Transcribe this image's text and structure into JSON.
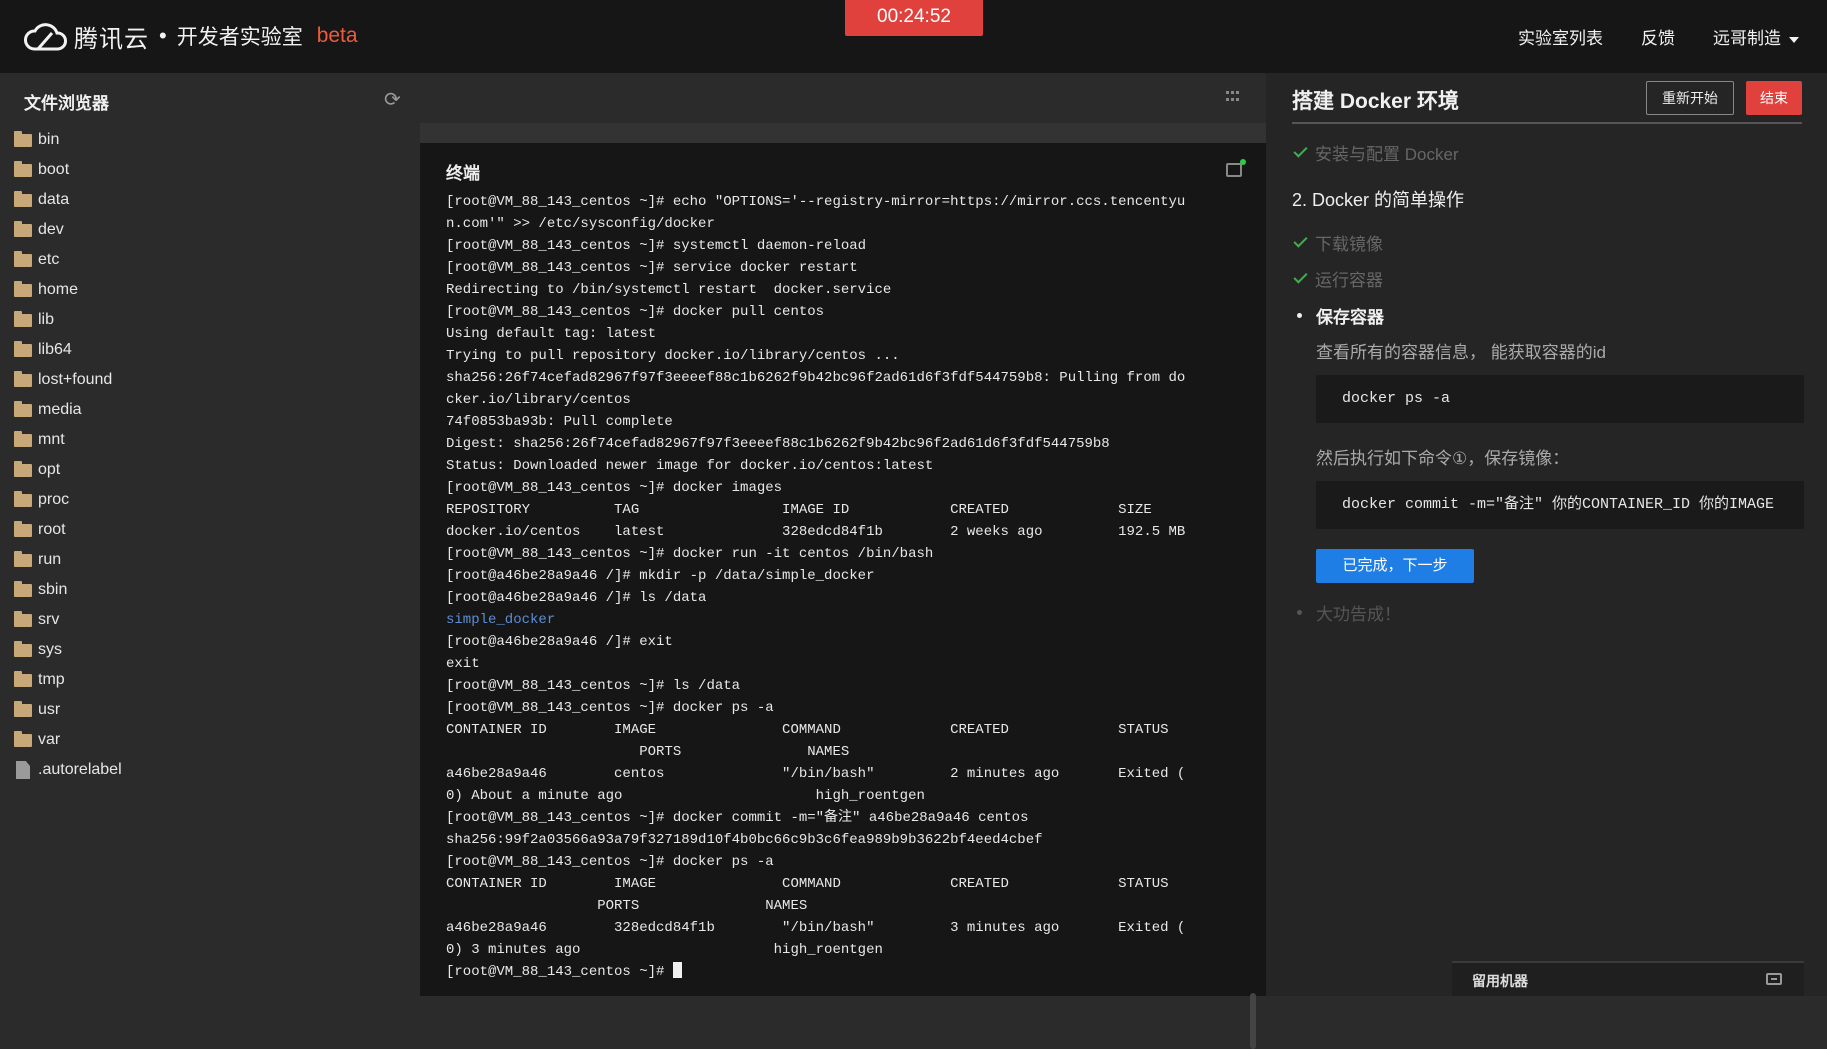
{
  "header": {
    "brand": "腾讯云",
    "separator": "•",
    "subtitle": "开发者实验室",
    "beta": "beta",
    "timer": "00:24:52",
    "nav": [
      "实验室列表",
      "反馈",
      "远哥制造"
    ]
  },
  "filebrowser": {
    "title": "文件浏览器",
    "items": [
      {
        "name": "bin",
        "type": "folder"
      },
      {
        "name": "boot",
        "type": "folder"
      },
      {
        "name": "data",
        "type": "folder"
      },
      {
        "name": "dev",
        "type": "folder"
      },
      {
        "name": "etc",
        "type": "folder"
      },
      {
        "name": "home",
        "type": "folder"
      },
      {
        "name": "lib",
        "type": "folder"
      },
      {
        "name": "lib64",
        "type": "folder"
      },
      {
        "name": "lost+found",
        "type": "folder"
      },
      {
        "name": "media",
        "type": "folder"
      },
      {
        "name": "mnt",
        "type": "folder"
      },
      {
        "name": "opt",
        "type": "folder"
      },
      {
        "name": "proc",
        "type": "folder"
      },
      {
        "name": "root",
        "type": "folder"
      },
      {
        "name": "run",
        "type": "folder"
      },
      {
        "name": "sbin",
        "type": "folder"
      },
      {
        "name": "srv",
        "type": "folder"
      },
      {
        "name": "sys",
        "type": "folder"
      },
      {
        "name": "tmp",
        "type": "folder"
      },
      {
        "name": "usr",
        "type": "folder"
      },
      {
        "name": "var",
        "type": "folder"
      },
      {
        "name": ".autorelabel",
        "type": "file"
      }
    ]
  },
  "terminal": {
    "title": "终端",
    "lines": [
      "[root@VM_88_143_centos ~]# echo \"OPTIONS='--registry-mirror=https://mirror.ccs.tencentyu",
      "n.com'\" >> /etc/sysconfig/docker",
      "[root@VM_88_143_centos ~]# systemctl daemon-reload",
      "[root@VM_88_143_centos ~]# service docker restart",
      "Redirecting to /bin/systemctl restart  docker.service",
      "[root@VM_88_143_centos ~]# docker pull centos",
      "Using default tag: latest",
      "Trying to pull repository docker.io/library/centos ...",
      "sha256:26f74cefad82967f97f3eeeef88c1b6262f9b42bc96f2ad61d6f3fdf544759b8: Pulling from do",
      "cker.io/library/centos",
      "74f0853ba93b: Pull complete",
      "Digest: sha256:26f74cefad82967f97f3eeeef88c1b6262f9b42bc96f2ad61d6f3fdf544759b8",
      "Status: Downloaded newer image for docker.io/centos:latest",
      "[root@VM_88_143_centos ~]# docker images",
      "REPOSITORY          TAG                 IMAGE ID            CREATED             SIZE",
      "docker.io/centos    latest              328edcd84f1b        2 weeks ago         192.5 MB",
      "[root@VM_88_143_centos ~]# docker run -it centos /bin/bash",
      "[root@a46be28a9a46 /]# mkdir -p /data/simple_docker",
      "[root@a46be28a9a46 /]# ls /data",
      "simple_docker",
      "[root@a46be28a9a46 /]# exit",
      "exit",
      "[root@VM_88_143_centos ~]# ls /data",
      "[root@VM_88_143_centos ~]# docker ps -a",
      "CONTAINER ID        IMAGE               COMMAND             CREATED             STATUS",
      "                       PORTS               NAMES",
      "a46be28a9a46        centos              \"/bin/bash\"         2 minutes ago       Exited (",
      "0) About a minute ago                       high_roentgen",
      "[root@VM_88_143_centos ~]# docker commit -m=\"备注\" a46be28a9a46 centos",
      "sha256:99f2a03566a93a79f327189d10f4b0bc66c9b3c6fea989b9b3622bf4eed4cbef",
      "[root@VM_88_143_centos ~]# docker ps -a",
      "CONTAINER ID        IMAGE               COMMAND             CREATED             STATUS",
      "                  PORTS               NAMES",
      "a46be28a9a46        328edcd84f1b        \"/bin/bash\"         3 minutes ago       Exited (",
      "0) 3 minutes ago                       high_roentgen",
      "[root@VM_88_143_centos ~]# "
    ],
    "highlight_line_index": 19
  },
  "guide": {
    "title": "搭建 Docker 环境",
    "restart_label": "重新开始",
    "end_label": "结束",
    "step_done_1": "安装与配置 Docker",
    "section2_title": "2. Docker 的简单操作",
    "step_done_2": "下载镜像",
    "step_done_3": "运行容器",
    "current_step": "保存容器",
    "desc1": "查看所有的容器信息， 能获取容器的id",
    "code1": "docker ps -a",
    "desc2": "然后执行如下命令①，保存镜像：",
    "code2": "docker commit -m=\"备注\" 你的CONTAINER_ID 你的IMAGE",
    "next_label": "已完成，下一步",
    "future_step": "大功告成！",
    "reserve_label": "留用机器"
  },
  "colors": {
    "accent_red": "#e0413d",
    "accent_blue": "#1f7ee6",
    "check_green": "#3eb04b",
    "beta_orange": "#ec5b3b"
  }
}
